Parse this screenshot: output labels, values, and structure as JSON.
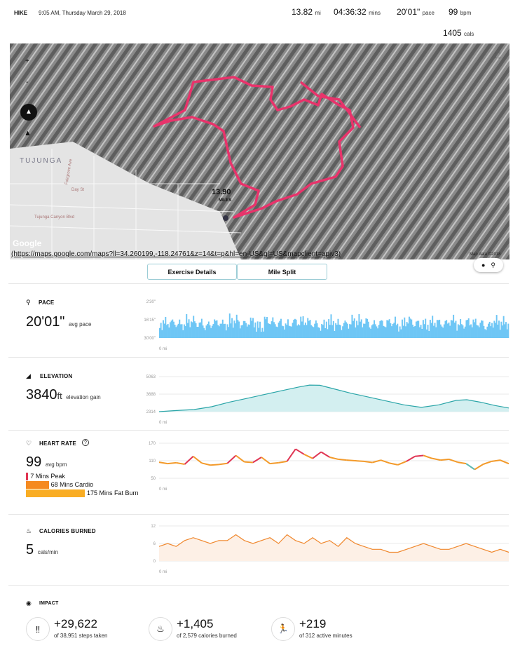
{
  "header": {
    "activity": "HIKE",
    "datetime": "9:05 AM, Thursday March 29, 2018",
    "distance": "13.82",
    "distance_unit": "mi",
    "duration": "04:36:32",
    "duration_unit": "mins",
    "pace": "20'01\"",
    "pace_unit": "pace",
    "heart_rate": "99",
    "heart_rate_unit": "bpm",
    "calories": "1405",
    "calories_unit": "cals"
  },
  "map": {
    "zoom_in": "+",
    "zoom_out": "-",
    "place_label": "TUJUNGA",
    "streets": [
      "Fairgrove Ave",
      "Day St",
      "Tujunga Canyon Blvd"
    ],
    "distance_marker": "13.90",
    "distance_marker_unit": "MILES",
    "logo": "Google",
    "url": "(https://maps.google.com/maps?ll=34.260199,-118.24761&z=14&t=p&hl=en-US&gl=US&mapclient=apiv3)",
    "attribution": "Map data ©2018",
    "route_color": "#e8336b",
    "terrain_icon": "mountain-icon"
  },
  "tabs": [
    {
      "label": "Exercise Details"
    },
    {
      "label": "Mile Split"
    }
  ],
  "pace": {
    "title": "PACE",
    "value": "20'01\"",
    "unit": "avg pace",
    "color": "#6ec6f5"
  },
  "elevation": {
    "title": "ELEVATION",
    "value": "3840",
    "unit_short": "ft",
    "unit": "elevation gain",
    "color": "#2aa5a8"
  },
  "heart_rate": {
    "title": "HEART RATE",
    "value": "99",
    "unit": "avg bpm",
    "zones": [
      {
        "label": "7 Mins Peak",
        "minutes": 7,
        "color": "#e03553"
      },
      {
        "label": "68 Mins Cardio",
        "minutes": 68,
        "color": "#f58a20"
      },
      {
        "label": "175 Mins Fat Burn",
        "minutes": 175,
        "color": "#f9ad24"
      }
    ]
  },
  "calories": {
    "title": "CALORIES BURNED",
    "value": "5",
    "unit": "cals/min",
    "color": "#f0882e"
  },
  "impact": {
    "title": "IMPACT",
    "items": [
      {
        "icon": "footsteps-icon",
        "value": "+29,622",
        "label": "of 38,951 steps taken"
      },
      {
        "icon": "flame-icon",
        "value": "+1,405",
        "label": "of 2,579 calories burned"
      },
      {
        "icon": "runner-icon",
        "value": "+219",
        "label": "of 312 active minutes"
      }
    ]
  },
  "chart_data": [
    {
      "type": "bar",
      "name": "pace",
      "yticks": [
        "2'30\"",
        "16'15\"",
        "30'00\""
      ],
      "xlabel": "0 mi",
      "ylim_minutes": [
        30,
        2.5
      ],
      "values": [
        18,
        17,
        19,
        16,
        18,
        20,
        17,
        19,
        16,
        18,
        17,
        21,
        16,
        18,
        19,
        17,
        16,
        18,
        20,
        17,
        19,
        18,
        16,
        17,
        19,
        18,
        17,
        20,
        16,
        18,
        19,
        17,
        18,
        16,
        19,
        17,
        18,
        20,
        17,
        18
      ]
    },
    {
      "type": "area",
      "name": "elevation",
      "yticks": [
        "5063",
        "3688",
        "2314"
      ],
      "xlabel": "0 mi",
      "ylim": [
        2314,
        5063
      ],
      "x": [
        0,
        0.05,
        0.1,
        0.15,
        0.2,
        0.25,
        0.3,
        0.35,
        0.4,
        0.43,
        0.46,
        0.5,
        0.55,
        0.6,
        0.65,
        0.7,
        0.75,
        0.8,
        0.85,
        0.88,
        0.92,
        0.96,
        1
      ],
      "values": [
        2314,
        2400,
        2480,
        2700,
        3050,
        3350,
        3650,
        3950,
        4250,
        4400,
        4380,
        4100,
        3750,
        3450,
        3150,
        2850,
        2650,
        2850,
        3200,
        3250,
        3050,
        2800,
        2600
      ]
    },
    {
      "type": "line",
      "name": "heart_rate",
      "yticks": [
        "170",
        "110",
        "50"
      ],
      "xlabel": "0 mi",
      "ylim": [
        50,
        170
      ],
      "values": [
        105,
        100,
        103,
        98,
        125,
        102,
        95,
        97,
        101,
        128,
        106,
        104,
        122,
        100,
        103,
        108,
        150,
        132,
        118,
        140,
        122,
        115,
        112,
        110,
        108,
        104,
        112,
        102,
        96,
        108,
        125,
        128,
        118,
        112,
        115,
        105,
        100,
        80,
        98,
        108,
        112,
        100
      ]
    },
    {
      "type": "area",
      "name": "calories",
      "yticks": [
        "12",
        "6",
        "0"
      ],
      "xlabel": "0 mi",
      "ylim": [
        0,
        12
      ],
      "values": [
        5,
        6,
        5,
        7,
        8,
        7,
        6,
        7,
        7,
        9,
        7,
        6,
        7,
        8,
        6,
        9,
        7,
        6,
        8,
        6,
        7,
        5,
        8,
        6,
        5,
        4,
        4,
        3,
        3,
        4,
        5,
        6,
        5,
        4,
        4,
        5,
        6,
        5,
        4,
        3,
        4,
        3
      ]
    }
  ]
}
